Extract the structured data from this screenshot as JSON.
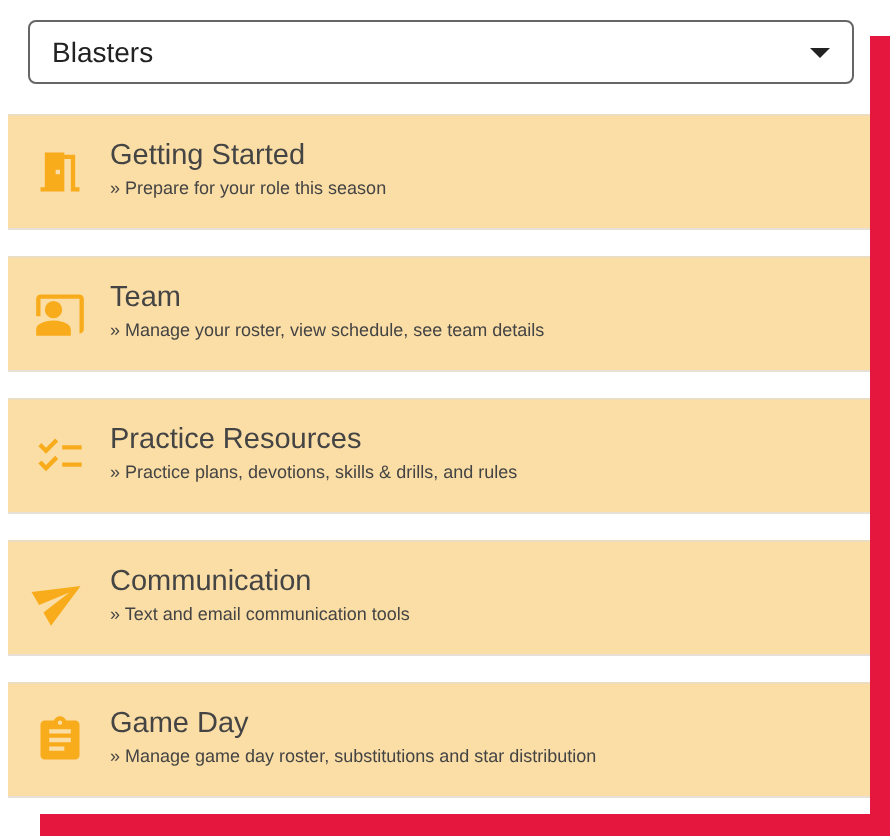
{
  "team_select": {
    "value": "Blasters"
  },
  "menu": [
    {
      "title": "Getting Started",
      "description": "» Prepare for your role this season"
    },
    {
      "title": "Team",
      "description": "» Manage your roster, view schedule, see team details"
    },
    {
      "title": "Practice Resources",
      "description": "» Practice plans, devotions, skills & drills, and rules"
    },
    {
      "title": "Communication",
      "description": "» Text and email communication tools"
    },
    {
      "title": "Game Day",
      "description": "» Manage game day roster, substitutions and star distribution"
    }
  ]
}
